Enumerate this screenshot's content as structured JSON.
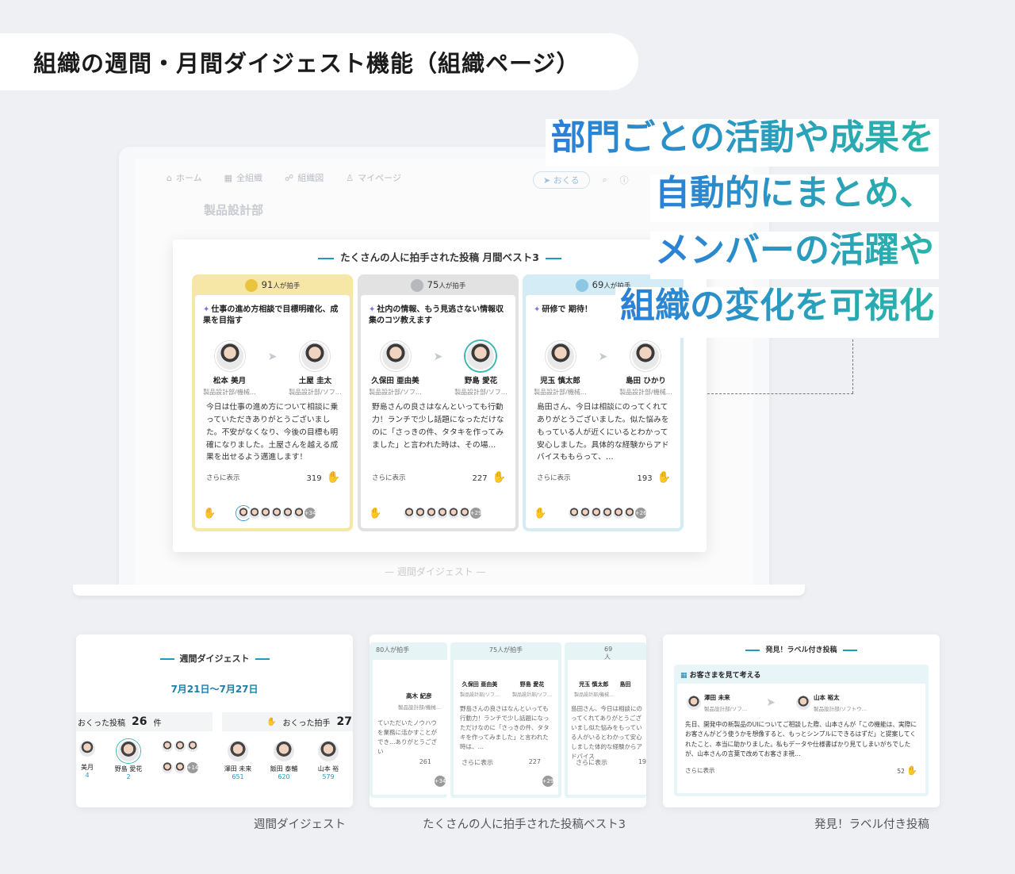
{
  "page_title": "組織の週間・月間ダイジェスト機能（組織ページ）",
  "headline": {
    "line1": "部門ごとの活動や成果を",
    "line2": "自動的にまとめ、",
    "line3": "メンバーの活躍や",
    "line4": "組織の変化を可視化"
  },
  "nav": {
    "home": "ホーム",
    "all": "全組織",
    "org": "組織図",
    "mypage": "マイページ",
    "send": "おくる"
  },
  "dept_name": "製品設計部",
  "weekly_faded": "週間ダイジェスト",
  "panel": {
    "title": "たくさんの人に拍手された投稿 月間ベスト3",
    "show_more": "さらに表示",
    "cards": [
      {
        "claps_num": "91",
        "claps_label": "人が拍手",
        "post_title": "仕事の進め方相談で目標明確化、成果を目指す",
        "from_name": "松本 美月",
        "from_dept": "製品設計部/機械…",
        "to_name": "土屋 圭太",
        "to_dept": "製品設計部/ソフ…",
        "body": "今日は仕事の進め方について相談に乗っていただきありがとうございました。不安がなくなり、今後の目標も明確になりました。土屋さんを越える成果を出せるよう邁進します！",
        "count": "319",
        "more_count": "+34"
      },
      {
        "claps_num": "75",
        "claps_label": "人が拍手",
        "post_title": "社内の情報、もう見逃さない情報収集のコツ教えます",
        "from_name": "久保田 亜由美",
        "from_dept": "製品設計部/ソフ…",
        "to_name": "野島 愛花",
        "to_dept": "製品設計部/ソフ…",
        "body": "野島さんの良さはなんといっても行動力！ランチで少し話題になっただけなのに「さっきの件、タタキを作ってみました」と言われた時は、その場…",
        "count": "227",
        "more_count": "+29"
      },
      {
        "claps_num": "69",
        "claps_label": "人が拍手",
        "post_title": "研修で 期待！",
        "from_name": "児玉 慎太郎",
        "from_dept": "製品設計部/機械…",
        "to_name": "島田 ひかり",
        "to_dept": "製品設計部/機械…",
        "body": "島田さん、今日は相談にのってくれてありがとうございました。似た悩みをもっている人が近くにいるとわかって安心しました。具体的な経験からアドバイスももらって、…",
        "count": "193",
        "more_count": "+26"
      }
    ]
  },
  "thumb1": {
    "title": "週間ダイジェスト",
    "date_range": "7月21日〜7月27日",
    "sent_label": "おくった投稿",
    "sent_count": "26",
    "sent_unit": "件",
    "clap_label": "おくった拍手",
    "clap_count": "27",
    "people": [
      {
        "name": "美月",
        "num": "4"
      },
      {
        "name": "野島 愛花",
        "num": "2"
      },
      {
        "name": "澤田 未来",
        "num": "651"
      },
      {
        "name": "飯田 泰輔",
        "num": "620"
      },
      {
        "name": "山本 裕",
        "num": "579"
      }
    ],
    "more": "+14"
  },
  "thumb2": {
    "c1_claps": "80人が拍手",
    "c2_claps": "75人が拍手",
    "c3_claps": "69人が拍手",
    "c1_name": "高木 紀彦",
    "c1_dept": "製品設計部/機械…",
    "c1_body": "ていただいたノウハウを業務に活かすことができ…ありがとうござい",
    "c1_count": "261",
    "c1_more": "+34",
    "c2_from": "久保田 亜由美",
    "c2_to": "野島 愛花",
    "c2_from_dept": "製品設計部/ソフ…",
    "c2_to_dept": "製品設計部/ソフ…",
    "c2_body": "野島さんの良さはなんといっても行動力！ランチで少し話題になっただけなのに「さっきの件、タタキを作ってみました」と言われた時は、…",
    "c2_count": "227",
    "c2_more": "+29",
    "c3_from": "児玉 慎太郎",
    "c3_to": "島田",
    "c3_dept": "製品設計部/機械…",
    "c3_body": "島田さん、今日は相談にのってくれてありがとうございまし似た悩みをもっている人がいるとわかって安心しました体的な経験からアドバイス",
    "c3_count": "19",
    "show_more": "さらに表示"
  },
  "thumb3": {
    "title": "発見！ラベル付き投稿",
    "label": "お客さまを見て考える",
    "from_name": "澤田 未来",
    "from_dept": "製品設計部/ソフ…",
    "to_name": "山本 裕太",
    "to_dept": "製品設計部/ソフトウ…",
    "body": "先日、開発中の新製品のUIについてご相談した際、山本さんが「この機能は、実際にお客さんがどう使うかを想像すると、もっとシンプルにできるはずだ」と提案してくれたこと、本当に助かりました。私もデータや仕様書ばかり見てしまいがちでしたが、山本さんの言葉で改めてお客さま視…",
    "show_more": "さらに表示",
    "count": "52"
  },
  "captions": {
    "c1": "週間ダイジェスト",
    "c2": "たくさんの人に拍手された投稿ベスト3",
    "c3": "発見！ラベル付き投稿"
  },
  "colors": {
    "gold": "#f7e7a6",
    "silver": "#e2e2e2",
    "blue": "#d3ecf6",
    "accent": "#1e9bbf",
    "clap": "#3a9ad9"
  }
}
